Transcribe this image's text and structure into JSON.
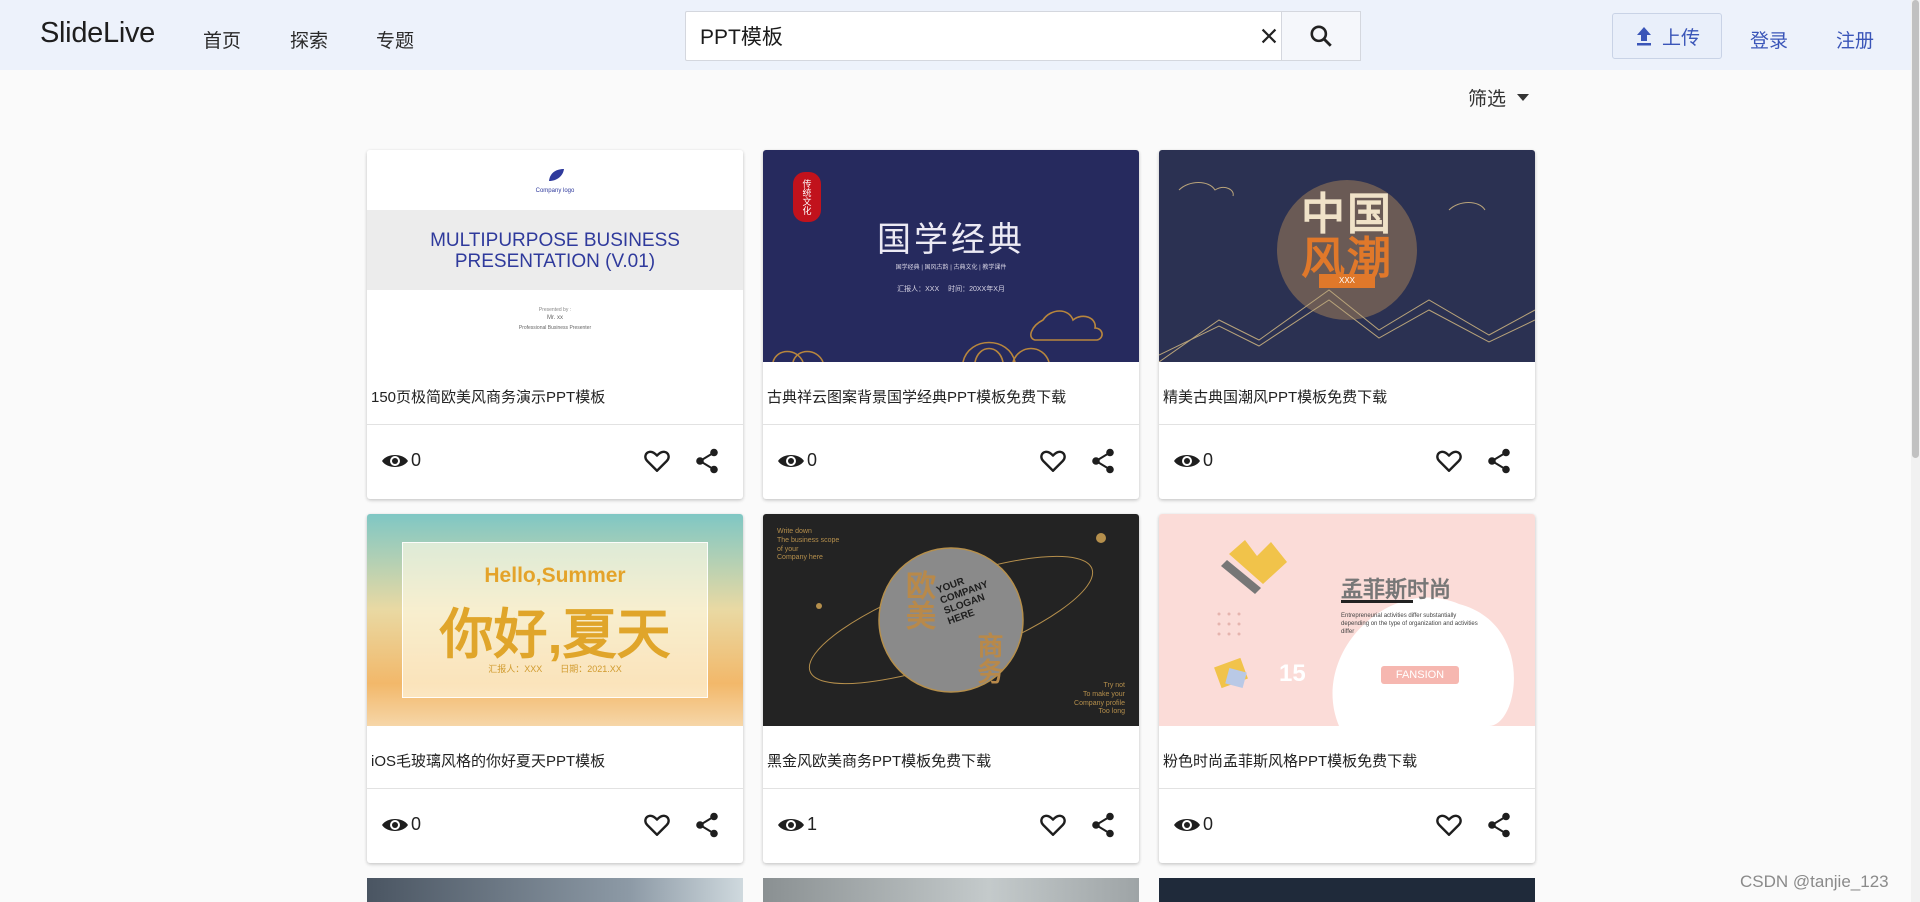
{
  "header": {
    "logo": "SlideLive",
    "nav": [
      "首页",
      "探索",
      "专题"
    ],
    "search_value": "PPT模板",
    "upload_label": "上传",
    "login_label": "登录",
    "register_label": "注册"
  },
  "filter_label": "筛选",
  "cards": [
    {
      "title": "150页极简欧美风商务演示PPT模板",
      "views": "0",
      "thumb": {
        "company_logo": "Company logo",
        "heading_line1": "MULTIPURPOSE BUSINESS",
        "heading_line2": "PRESENTATION (V.01)",
        "presented_by": "Presented by :",
        "presenter": "Mr. xx",
        "role": "Professional Business Presenter"
      }
    },
    {
      "title": "古典祥云图案背景国学经典PPT模板免费下载",
      "views": "0",
      "thumb": {
        "seal": "传统文化",
        "heading": "国学经典",
        "subtitle": "国学经典 | 国风古韵 | 古典文化 | 教学课件",
        "reporter": "汇报人：XXX　 时间：20XX年X月"
      }
    },
    {
      "title": "精美古典国潮风PPT模板免费下载",
      "views": "0",
      "thumb": {
        "line1": "中国",
        "line2": "风潮",
        "tag": "XXX"
      }
    },
    {
      "title": "iOS毛玻璃风格的你好夏天PPT模板",
      "views": "0",
      "thumb": {
        "en": "Hello,Summer",
        "cn": "你好,夏天",
        "meta": "汇报人：XXX　　日期：2021.XX"
      }
    },
    {
      "title": "黑金风欧美商务PPT模板免费下载",
      "views": "1",
      "thumb": {
        "tl": "Write down\nThe business scope\nof your\nCompany here",
        "globe": "YOUR\nCOMPANY\nSLOGAN\nHERE",
        "vert": "欧美",
        "vert2": "商务",
        "br": "Try not\nTo make your\nCompany profile\nToo long"
      }
    },
    {
      "title": "粉色时尚孟菲斯风格PPT模板免费下载",
      "views": "0",
      "thumb": {
        "heading": "孟菲斯时尚",
        "desc": "Entrepreneurial activities differ substantially depending on the type of organization and activities differ",
        "num": "15",
        "tag": "FANSION"
      }
    }
  ],
  "watermark": "CSDN @tanjie_123",
  "colors": {
    "accent": "#3a55b8",
    "header_bg": "#edf2fb",
    "page_bg": "#fafafa"
  }
}
